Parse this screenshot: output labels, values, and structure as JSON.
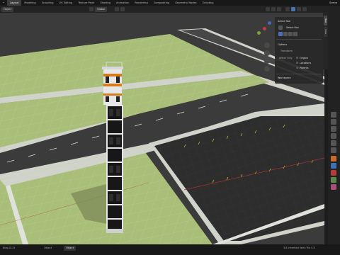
{
  "topbar": {
    "tabs": [
      "Layout",
      "Modeling",
      "Sculpting",
      "UV Editing",
      "Texture Paint",
      "Shading",
      "Animation",
      "Rendering",
      "Compositing",
      "Geometry Nodes",
      "Scripting"
    ],
    "active_tab": "Layout",
    "scene": "Scene"
  },
  "viewheader": {
    "mode": "Object",
    "orientation": "Global",
    "options": "Options"
  },
  "npanel": {
    "active_tool_title": "Active Tool",
    "select_box": "Select Box",
    "options_title": "Options",
    "transform": "Transform",
    "affect_only": "Affect Only",
    "origins": "Origins",
    "locations": "Locations",
    "parents": "Parents",
    "workspace": "Workspace"
  },
  "sidetabs": [
    "Tool",
    "View"
  ],
  "status": {
    "file": "Bldg.0113",
    "object": "Object",
    "mode": "Object",
    "info": "3.6 Inherited  Verts  Tris 4.5"
  },
  "colors": {
    "grass": "#a9be79",
    "sidewalk": "#cfd3c9",
    "road": "#3b3b3b",
    "lot": "#2b2c2b",
    "accent": "#4772b3"
  }
}
